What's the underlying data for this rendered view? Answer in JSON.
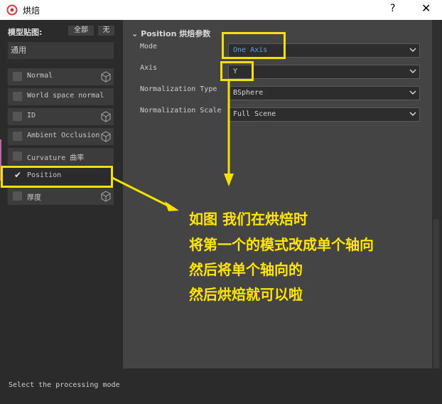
{
  "window": {
    "title": "烘焙",
    "help_label": "?",
    "close_label": "✕"
  },
  "left": {
    "maps_label": "模型贴图:",
    "select_all": "全部",
    "select_none": "无",
    "common": "通用",
    "items": [
      {
        "label": "Normal",
        "checked": false,
        "icon": "cube-icon"
      },
      {
        "label": "World space normal",
        "checked": false,
        "icon": ""
      },
      {
        "label": "ID",
        "checked": false,
        "icon": "cube-icon"
      },
      {
        "label": "Ambient Occlusion",
        "checked": false,
        "icon": "cube-icon"
      },
      {
        "label": "Curvature 曲率",
        "checked": false,
        "icon": ""
      },
      {
        "label": "Position",
        "checked": true,
        "icon": ""
      },
      {
        "label": "厚度",
        "checked": false,
        "icon": "cube-icon"
      }
    ]
  },
  "section": {
    "title": "Position 烘焙参数"
  },
  "props": [
    {
      "label": "Mode",
      "value": "One Axis"
    },
    {
      "label": "Axis",
      "value": "Y"
    },
    {
      "label": "Normalization Type",
      "value": "BSphere"
    },
    {
      "label": "Normalization Scale",
      "value": "Full Scene"
    }
  ],
  "annotation": {
    "lines": [
      "如图 我们在烘焙时",
      "将第一个的模式改成单个轴向",
      "然后将单个轴向的",
      "然后烘焙就可以啦"
    ],
    "color": "#ffe600"
  },
  "status": {
    "text": "Select the processing mode"
  },
  "colors": {
    "accent": "#b86aa8",
    "highlight": "#f5e100",
    "value_blue": "#5aa0e8"
  }
}
